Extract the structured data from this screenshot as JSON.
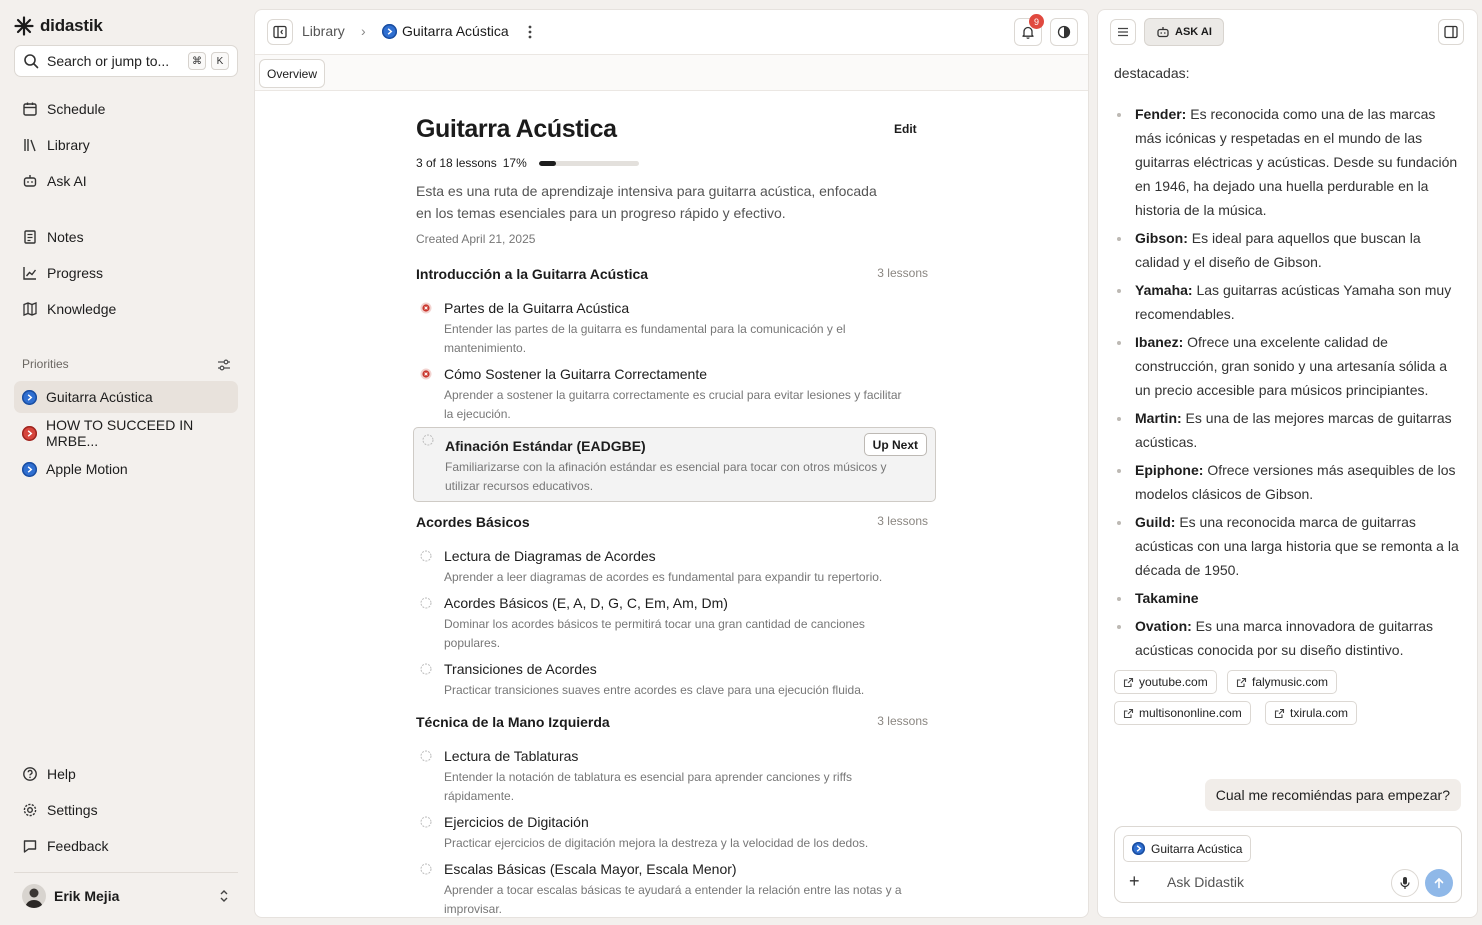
{
  "app": {
    "name": "didastik"
  },
  "search": {
    "placeholder": "Search or jump to...",
    "key1": "⌘",
    "key2": "K"
  },
  "nav": {
    "schedule": "Schedule",
    "library": "Library",
    "ask_ai": "Ask AI",
    "notes": "Notes",
    "progress": "Progress",
    "knowledge": "Knowledge"
  },
  "priorities": {
    "label": "Priorities",
    "items": [
      {
        "label": "Guitarra Acústica",
        "color": "#2f6fd1"
      },
      {
        "label": "HOW TO SUCCEED IN MRBE...",
        "color": "#d6453c"
      },
      {
        "label": "Apple Motion",
        "color": "#2f6fd1"
      }
    ]
  },
  "footer_nav": {
    "help": "Help",
    "settings": "Settings",
    "feedback": "Feedback"
  },
  "user": {
    "name": "Erik Mejia"
  },
  "header": {
    "breadcrumb_root": "Library",
    "breadcrumb_current": "Guitarra Acústica",
    "notifications": "9"
  },
  "tabs": {
    "overview": "Overview"
  },
  "course": {
    "title": "Guitarra Acústica",
    "edit_label": "Edit",
    "progress_text": "3 of 18 lessons",
    "progress_percent": "17%",
    "progress_fraction": 0.17,
    "description": "Esta es una ruta de aprendizaje intensiva para guitarra acústica, enfocada en los temas esenciales para un progreso rápido y efectivo.",
    "created": "Created April 21, 2025"
  },
  "sections": [
    {
      "title": "Introducción a la Guitarra Acústica",
      "count": "3 lessons",
      "lessons": [
        {
          "title": "Partes de la Guitarra Acústica",
          "desc": "Entender las partes de la guitarra es fundamental para la comunicación y el mantenimiento.",
          "status": "completed"
        },
        {
          "title": "Cómo Sostener la Guitarra Correctamente",
          "desc": "Aprender a sostener la guitarra correctamente es crucial para evitar lesiones y facilitar la ejecución.",
          "status": "completed"
        },
        {
          "title": "Afinación Estándar (EADGBE)",
          "desc": "Familiarizarse con la afinación estándar es esencial para tocar con otros músicos y utilizar recursos educativos.",
          "status": "next",
          "badge": "Up Next"
        }
      ]
    },
    {
      "title": "Acordes Básicos",
      "count": "3 lessons",
      "lessons": [
        {
          "title": "Lectura de Diagramas de Acordes",
          "desc": "Aprender a leer diagramas de acordes es fundamental para expandir tu repertorio."
        },
        {
          "title": "Acordes Básicos (E, A, D, G, C, Em, Am, Dm)",
          "desc": "Dominar los acordes básicos te permitirá tocar una gran cantidad de canciones populares."
        },
        {
          "title": "Transiciones de Acordes",
          "desc": "Practicar transiciones suaves entre acordes es clave para una ejecución fluida."
        }
      ]
    },
    {
      "title": "Técnica de la Mano Izquierda",
      "count": "3 lessons",
      "lessons": [
        {
          "title": "Lectura de Tablaturas",
          "desc": "Entender la notación de tablatura es esencial para aprender canciones y riffs rápidamente."
        },
        {
          "title": "Ejercicios de Digitación",
          "desc": "Practicar ejercicios de digitación mejora la destreza y la velocidad de los dedos."
        },
        {
          "title": "Escalas Básicas (Escala Mayor, Escala Menor)",
          "desc": "Aprender a tocar escalas básicas te ayudará a entender la relación entre las notas y a improvisar."
        }
      ]
    }
  ],
  "chat": {
    "ask_ai_label": "ASK AI",
    "intro_tail": "destacadas:",
    "brands": [
      {
        "name": "Fender:",
        "text": " Es reconocida como una de las marcas más icónicas y respetadas en el mundo de las guitarras eléctricas y acústicas. Desde su fundación en 1946, ha dejado una huella perdurable en la historia de la música."
      },
      {
        "name": "Gibson:",
        "text": " Es ideal para aquellos que buscan la calidad y el diseño de Gibson."
      },
      {
        "name": "Yamaha:",
        "text": " Las guitarras acústicas Yamaha son muy recomendables."
      },
      {
        "name": "Ibanez:",
        "text": " Ofrece una excelente calidad de construcción, gran sonido y una artesanía sólida a un precio accesible para músicos principiantes."
      },
      {
        "name": "Martin:",
        "text": " Es una de las mejores marcas de guitarras acústicas."
      },
      {
        "name": "Epiphone:",
        "text": " Ofrece versiones más asequibles de los modelos clásicos de Gibson."
      },
      {
        "name": "Guild:",
        "text": " Es una reconocida marca de guitarras acústicas con una larga historia que se remonta a la década de 1950."
      },
      {
        "name": "Takamine",
        "text": ""
      },
      {
        "name": "Ovation:",
        "text": " Es una marca innovadora de guitarras acústicas conocida por su diseño distintivo."
      }
    ],
    "sources": [
      "youtube.com",
      "falymusic.com",
      "multisononline.com",
      "txirula.com"
    ],
    "user_message": "Cual me recomiéndas para empezar?",
    "context_chip": "Guitarra Acústica",
    "input_placeholder": "Ask Didastik"
  }
}
